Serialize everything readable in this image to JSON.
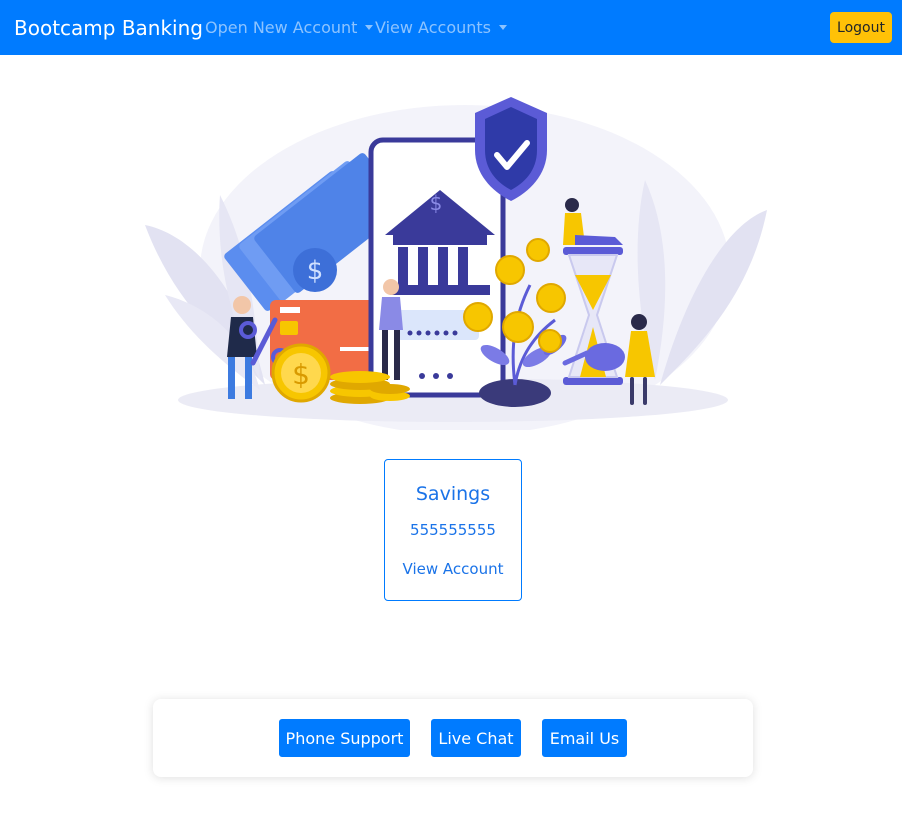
{
  "navbar": {
    "brand": "Bootcamp Banking",
    "menus": [
      {
        "label": "Open New Account"
      },
      {
        "label": "View Accounts"
      }
    ],
    "logout_label": "Logout"
  },
  "colors": {
    "primary": "#007bff",
    "logout": "#ffc107",
    "illustration_accent": "#5b5bd6",
    "coin": "#f7c600"
  },
  "account_card": {
    "title": "Savings",
    "number": "555555555",
    "link_label": "View Account"
  },
  "support": {
    "buttons": [
      {
        "label": "Phone Support"
      },
      {
        "label": "Live Chat"
      },
      {
        "label": "Email Us"
      }
    ]
  }
}
